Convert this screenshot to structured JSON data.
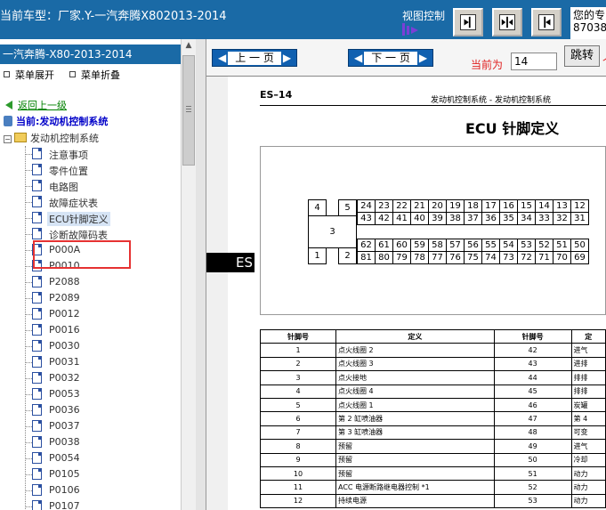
{
  "top": {
    "car_model": "当前车型：厂家.Y-一汽奔腾X802013-2014",
    "view_control_label": "视图控制",
    "right_text": "您的专",
    "right_number": "87038"
  },
  "left": {
    "title": "一汽奔腾-X80-2013-2014",
    "expand_label": "菜单展开",
    "collapse_label": "菜单折叠",
    "back_label": "返回上一级",
    "current_label": "当前:发动机控制系统",
    "folder_label": "发动机控制系统",
    "items": [
      "注意事项",
      "零件位置",
      "电路图",
      "故障症状表",
      "ECU针脚定义",
      "诊断故障码表",
      "P000A",
      "P0010",
      "P2088",
      "P2089",
      "P0012",
      "P0016",
      "P0030",
      "P0031",
      "P0032",
      "P0053",
      "P0036",
      "P0037",
      "P0038",
      "P0054",
      "P0105",
      "P0106",
      "P0107"
    ]
  },
  "nav": {
    "prev_label": "上 一 页",
    "next_label": "下 一 页",
    "current_label": "当前为",
    "page_value": "14",
    "jump_label": "跳转",
    "edge_mark": "个"
  },
  "doc": {
    "side_tab": "ES",
    "page_code": "ES–14",
    "header_text": "发动机控制系统  -  发动机控制系统",
    "title": "ECU 针脚定义",
    "connector_left": {
      "top": [
        "4",
        "5"
      ],
      "middle": "3",
      "bottom": [
        "1",
        "2"
      ]
    },
    "connector_rows": [
      [
        "24",
        "23",
        "22",
        "21",
        "20",
        "19",
        "18",
        "17",
        "16",
        "15",
        "14",
        "13",
        "12"
      ],
      [
        "43",
        "42",
        "41",
        "40",
        "39",
        "38",
        "37",
        "36",
        "35",
        "34",
        "33",
        "32",
        "31"
      ],
      [
        "62",
        "61",
        "60",
        "59",
        "58",
        "57",
        "56",
        "55",
        "54",
        "53",
        "52",
        "51",
        "50"
      ],
      [
        "81",
        "80",
        "79",
        "78",
        "77",
        "76",
        "75",
        "74",
        "73",
        "72",
        "71",
        "70",
        "69"
      ]
    ],
    "table_headers": [
      "针脚号",
      "定义",
      "针脚号",
      "定"
    ],
    "table_rows": [
      [
        "1",
        "点火线圈 2",
        "42",
        "进气"
      ],
      [
        "2",
        "点火线圈 3",
        "43",
        "进排"
      ],
      [
        "3",
        "点火接地",
        "44",
        "排排"
      ],
      [
        "4",
        "点火线圈 4",
        "45",
        "排排"
      ],
      [
        "5",
        "点火线圈 1",
        "46",
        "炭罐"
      ],
      [
        "6",
        "第 2 缸喷油器",
        "47",
        "第 4"
      ],
      [
        "7",
        "第 3 缸喷油器",
        "48",
        "可变"
      ],
      [
        "8",
        "预留",
        "49",
        "进气"
      ],
      [
        "9",
        "预留",
        "50",
        "冷却"
      ],
      [
        "10",
        "预留",
        "51",
        "动力"
      ],
      [
        "11",
        "ACC 电源断路继电器控制 *1",
        "52",
        "动力"
      ],
      [
        "12",
        "持续电源",
        "53",
        "动力"
      ]
    ]
  }
}
